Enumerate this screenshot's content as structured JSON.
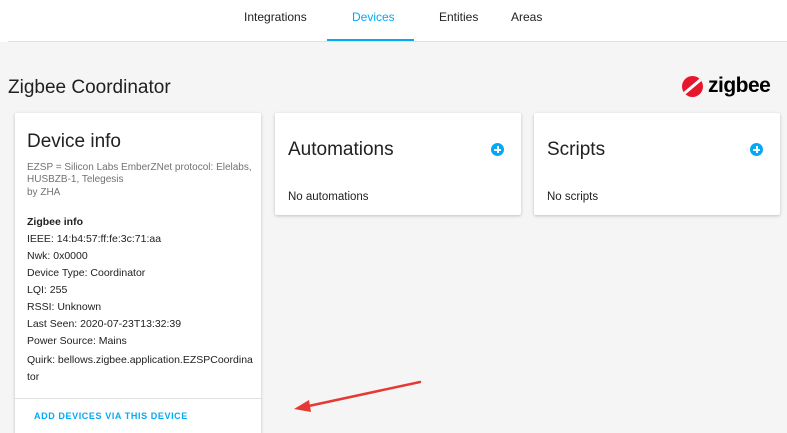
{
  "tabs": [
    {
      "label": "Integrations",
      "active": false
    },
    {
      "label": "Devices",
      "active": true
    },
    {
      "label": "Entities",
      "active": false
    },
    {
      "label": "Areas",
      "active": false
    }
  ],
  "page": {
    "title": "Zigbee Coordinator"
  },
  "logo": {
    "text": "zigbee",
    "mark_color": "#e6162d"
  },
  "device_info": {
    "heading": "Device info",
    "model": "EZSP = Silicon Labs EmberZNet protocol: Elelabs, HUSBZB-1, Telegesis",
    "by": "by ZHA",
    "zigbee_title": "Zigbee info",
    "rows": [
      "IEEE: 14:b4:57:ff:fe:3c:71:aa",
      "Nwk: 0x0000",
      "Device Type: Coordinator",
      "LQI: 255",
      "RSSI: Unknown",
      "Last Seen: 2020-07-23T13:32:39",
      "Power Source: Mains"
    ],
    "quirk": "Quirk: bellows.zigbee.application.EZSPCoordinator",
    "action_label": "ADD DEVICES VIA THIS DEVICE"
  },
  "automations": {
    "heading": "Automations",
    "empty_text": "No automations"
  },
  "scripts": {
    "heading": "Scripts",
    "empty_text": "No scripts"
  },
  "icons": {
    "add": "plus-circle-icon",
    "annotation": "red-arrow-icon"
  },
  "colors": {
    "accent": "#03a9f4",
    "annotation": "#e53935"
  }
}
